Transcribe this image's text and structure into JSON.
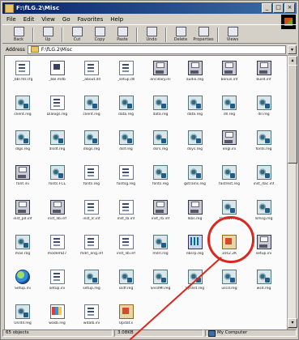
{
  "window": {
    "title": "F:\\fLG.2\\Misc",
    "buttons": [
      "_",
      "□",
      "×"
    ]
  },
  "menu": [
    "File",
    "Edit",
    "View",
    "Go",
    "Favorites",
    "Help"
  ],
  "toolbar": [
    {
      "label": "Back"
    },
    {
      "label": "Up"
    },
    {
      "label": "Cut"
    },
    {
      "label": "Copy"
    },
    {
      "label": "Paste"
    },
    {
      "label": "Undo"
    },
    {
      "label": "Delete"
    },
    {
      "label": "Properties"
    },
    {
      "label": "Views"
    }
  ],
  "address": {
    "label": "Address",
    "value": "F:\\fLG.2\\Misc"
  },
  "files": [
    {
      "name": "_bbl.fdr.cfg",
      "icon": "doc-icon"
    },
    {
      "name": "_bbl.mdb",
      "icon": "screen-icon"
    },
    {
      "name": "_about.dll",
      "icon": "doc-icon"
    },
    {
      "name": "_setup.dll",
      "icon": "doc-icon"
    },
    {
      "name": "ancillary.ini",
      "icon": "disk-icon"
    },
    {
      "name": "audio.reg",
      "icon": "disk-icon"
    },
    {
      "name": "bonus.inf",
      "icon": "disk-icon"
    },
    {
      "name": "build.inf",
      "icon": "disk-icon"
    },
    {
      "name": "client.reg",
      "icon": "gear-icon"
    },
    {
      "name": "Dialogs.reg",
      "icon": "doc-icon"
    },
    {
      "name": "client.reg",
      "icon": "gear-icon"
    },
    {
      "name": "data.reg",
      "icon": "gear-icon"
    },
    {
      "name": "data.reg",
      "icon": "gear-icon"
    },
    {
      "name": "data.reg",
      "icon": "gear-icon"
    },
    {
      "name": "dll.reg",
      "icon": "gear-icon"
    },
    {
      "name": "dll.reg",
      "icon": "gear-icon"
    },
    {
      "name": "dlgs.reg",
      "icon": "gear-icon"
    },
    {
      "name": "dlsdt.reg",
      "icon": "gear-icon"
    },
    {
      "name": "dlsgs.reg",
      "icon": "gear-icon"
    },
    {
      "name": "dslf.reg",
      "icon": "gear-icon"
    },
    {
      "name": "dsrs.reg",
      "icon": "gear-icon"
    },
    {
      "name": "dsys.reg",
      "icon": "gear-icon"
    },
    {
      "name": "engl.ini",
      "icon": "disk-icon"
    },
    {
      "name": "fonts.reg",
      "icon": "gear-icon"
    },
    {
      "name": "font.ini",
      "icon": "disk-icon"
    },
    {
      "name": "fonts.FCL",
      "icon": "gear-icon"
    },
    {
      "name": "fonts.reg",
      "icon": "doc-icon"
    },
    {
      "name": "fontsg.reg",
      "icon": "doc-icon"
    },
    {
      "name": "fonts.reg",
      "icon": "gear-icon"
    },
    {
      "name": "gstrains.reg",
      "icon": "gear-icon"
    },
    {
      "name": "fastrest.reg",
      "icon": "gear-icon"
    },
    {
      "name": "inst_dac.inf",
      "icon": "gear-icon"
    },
    {
      "name": "inst_pd.inf",
      "icon": "disk-icon"
    },
    {
      "name": "inst_lib.inf",
      "icon": "disk-icon"
    },
    {
      "name": "inst_lc.inf",
      "icon": "doc-icon"
    },
    {
      "name": "inst_lb.inf",
      "icon": "doc-icon"
    },
    {
      "name": "inst_rb.inf",
      "icon": "disk-icon"
    },
    {
      "name": "lkbs.reg",
      "icon": "disk-icon"
    },
    {
      "name": "fastsbt.reg",
      "icon": "gear-icon"
    },
    {
      "name": "lsmsg.reg",
      "icon": "gear-icon"
    },
    {
      "name": "mail.reg",
      "icon": "gear-icon"
    },
    {
      "name": "modemD7",
      "icon": "doc-icon"
    },
    {
      "name": "mdrl_eng.inf",
      "icon": "doc-icon"
    },
    {
      "name": "inst_lib.inf",
      "icon": "doc-icon"
    },
    {
      "name": "mdrl.reg",
      "icon": "gear-icon"
    },
    {
      "name": "nbsrp.reg",
      "icon": "multi-icon"
    },
    {
      "name": "10s2.2K",
      "icon": "pkg-icon"
    },
    {
      "name": "setup.ini",
      "icon": "disk-icon"
    },
    {
      "name": "Setup.ini",
      "icon": "globe-icon"
    },
    {
      "name": "setup.ini",
      "icon": "doc-icon"
    },
    {
      "name": "setup.reg",
      "icon": "gear-icon"
    },
    {
      "name": "ssdf.reg",
      "icon": "gear-icon"
    },
    {
      "name": "SnsdMl.reg",
      "icon": "gear-icon"
    },
    {
      "name": "Syslist.reg",
      "icon": "gear-icon"
    },
    {
      "name": "uscd.reg",
      "icon": "gear-icon"
    },
    {
      "name": "wsd.reg",
      "icon": "gear-icon"
    },
    {
      "name": "Usrdll.reg",
      "icon": "gear-icon"
    },
    {
      "name": "wasb.reg",
      "icon": "block-icon"
    },
    {
      "name": "wdalb.ini",
      "icon": "doc-icon"
    },
    {
      "name": "Updat.s",
      "icon": "pkg-icon"
    }
  ],
  "status": {
    "objects": "65 objects",
    "size": "3.08KB",
    "zone": "My Computer"
  }
}
